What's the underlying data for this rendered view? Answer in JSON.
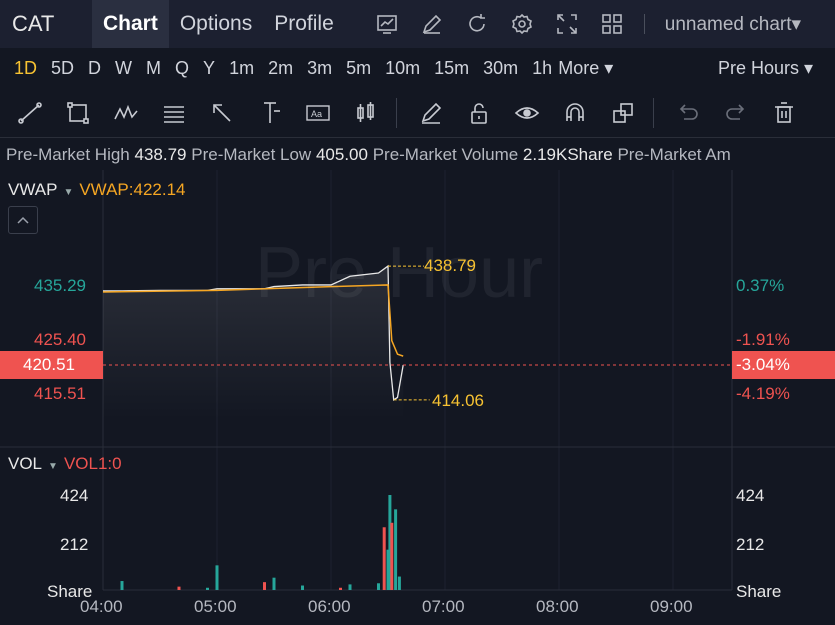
{
  "header": {
    "symbol": "CAT",
    "tabs": [
      "Chart",
      "Options",
      "Profile"
    ],
    "chart_name": "unnamed chart▾"
  },
  "timeframes": [
    "1D",
    "5D",
    "D",
    "W",
    "M",
    "Q",
    "Y",
    "1m",
    "2m",
    "3m",
    "5m",
    "10m",
    "15m",
    "30m",
    "1h"
  ],
  "more_label": "More ▾",
  "session_label": "Pre Hours ▾",
  "info": {
    "high_label": "Pre-Market High",
    "high_value": "438.79",
    "low_label": "Pre-Market Low",
    "low_value": "405.00",
    "volume_label": "Pre-Market Volume",
    "volume_value": "2.19KShare",
    "amount_label": "Pre-Market Am"
  },
  "price_pane": {
    "indicator": "VWAP",
    "indicator_value": "VWAP:422.14",
    "watermark": "Pre Hour",
    "left_axis": [
      "435.29",
      "425.40",
      "420.51",
      "415.51"
    ],
    "right_axis": [
      "0.37%",
      "-1.91%",
      "-3.04%",
      "-4.19%"
    ],
    "high_marker": "438.79",
    "low_marker": "414.06"
  },
  "volume_pane": {
    "indicator": "VOL",
    "indicator_value": "VOL1:0",
    "left_axis": [
      "424",
      "212",
      "Share"
    ],
    "right_axis": [
      "424",
      "212",
      "Share"
    ]
  },
  "time_axis": [
    "04:00",
    "05:00",
    "06:00",
    "07:00",
    "08:00",
    "09:00"
  ],
  "colors": {
    "up": "#26a69a",
    "down": "#ef5350",
    "vwap": "#f5a623",
    "active_timeframe": "#f7c232"
  },
  "chart_data": {
    "type": "line",
    "series": [
      {
        "x": [
          "04:00",
          "04:10",
          "04:30",
          "04:55",
          "05:00",
          "05:25",
          "05:30",
          "05:45",
          "06:00",
          "06:10",
          "06:25",
          "06:30",
          "06:31",
          "06:33",
          "06:35",
          "06:38"
        ],
        "values": [
          434.2,
          434.2,
          434.3,
          434.3,
          434.6,
          434.6,
          435.0,
          435.3,
          435.3,
          436.9,
          437.5,
          438.79,
          421.0,
          414.06,
          414.5,
          420.51
        ]
      },
      {
        "name": "VWAP",
        "x": [
          "04:00",
          "05:00",
          "06:00",
          "06:30",
          "06:32",
          "06:35",
          "06:38"
        ],
        "values": [
          434.0,
          434.3,
          435.0,
          435.3,
          425.0,
          422.5,
          422.14
        ]
      }
    ],
    "volume": {
      "x": [
        "04:10",
        "04:40",
        "04:55",
        "05:00",
        "05:25",
        "05:30",
        "05:45",
        "06:05",
        "06:10",
        "06:25",
        "06:28",
        "06:30",
        "06:31",
        "06:32",
        "06:34",
        "06:36"
      ],
      "values": [
        40,
        15,
        10,
        110,
        35,
        55,
        20,
        10,
        25,
        30,
        280,
        180,
        424,
        300,
        360,
        60
      ]
    },
    "ylim": [
      414,
      440
    ]
  }
}
